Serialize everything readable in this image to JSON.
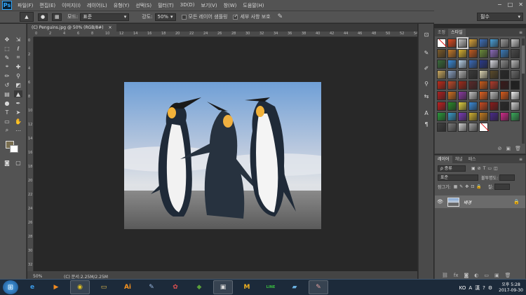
{
  "menubar": {
    "logo": "Ps",
    "items": [
      "파일(F)",
      "편집(E)",
      "이미지(I)",
      "레이어(L)",
      "유형(Y)",
      "선택(S)",
      "필터(T)",
      "3D(D)",
      "보기(V)",
      "창(W)",
      "도움말(H)"
    ],
    "window_controls": [
      "−",
      "□",
      "✕"
    ]
  },
  "options_bar": {
    "mode_label": "모드:",
    "mode_value": "표준",
    "strength_label": "강도:",
    "strength_value": "50%",
    "sample_all_layers_label": "모든 레이어 샘플링",
    "sample_all_layers_checked": false,
    "protect_detail_label": "세부 사항 보호",
    "protect_detail_checked": true,
    "workspace": "필수"
  },
  "document": {
    "tab_title": "(C) Penguins.jpg @ 50% (RGB/8#)",
    "tab_close": "×",
    "ruler_top_ticks": [
      "0",
      "2",
      "4",
      "6",
      "8",
      "10",
      "12",
      "14",
      "16",
      "18",
      "20",
      "22",
      "24",
      "26",
      "28",
      "30",
      "32",
      "34",
      "36",
      "38",
      "40",
      "42",
      "44",
      "46",
      "48",
      "50",
      "52",
      "54"
    ],
    "ruler_left_ticks": [
      "0",
      "2",
      "4",
      "6",
      "8",
      "10",
      "12",
      "14",
      "16",
      "18",
      "20",
      "22",
      "24",
      "26",
      "28",
      "30",
      "32"
    ]
  },
  "status_bar": {
    "zoom": "50%",
    "doc_info": "(C) 문서:2.25M/2.25M"
  },
  "panels": {
    "top_tabs": [
      "조정",
      "스타일"
    ],
    "top_active": "스타일",
    "style_swatch_colors": [
      "none",
      "#e04a1f",
      "#bfbfbf",
      "#d9a33a",
      "#3d6fb8",
      "#4aa0d8",
      "#9a9a9a",
      "#c8c8c8",
      "#7a5a2a",
      "#c47a2a",
      "#d8b030",
      "#c05a20",
      "#6a8a3a",
      "#8a6ab8",
      "#3a7ab8",
      "#4a4a4a",
      "#3a6a3a",
      "#3a8ad8",
      "#b8d0e8",
      "#3a6ab8",
      "#2a3a8a",
      "#d8d8e0",
      "#8a8a8a",
      "#b8b8b8",
      "#c8a860",
      "#8aa0c0",
      "#b0b0b0",
      "#3a3a3a",
      "#d8d0b0",
      "#5a4a2a",
      "#2a2a2a",
      "#6a6a6a",
      "#c02a1a",
      "#c04a2a",
      "#a02a1a",
      "#5a2a2a",
      "#c85a1a",
      "#b03a2a",
      "#3a1a1a",
      "#202020",
      "#b02020",
      "#d07020",
      "#8a3aa0",
      "#c0c0c0",
      "#e06020",
      "#b8b8b8",
      "#d85a1a",
      "#f0f0f0",
      "#c02020",
      "#2a8a2a",
      "#e0d040",
      "#3a8ad8",
      "#c84a20",
      "#8a1a1a",
      "#2a2a2a",
      "#d0d0d0",
      "#2a9a3a",
      "#3a9ac8",
      "#7a3ab8",
      "#d0b030",
      "#c07a20",
      "#4a2a8a",
      "#d02a8a",
      "#3aaa5a",
      "#404040",
      "#7a7a7a",
      "#cfcfcf",
      "#a0a0a0",
      "none"
    ],
    "layers_tabs": [
      "레이어",
      "채널",
      "패스"
    ],
    "layers_active": "레이어",
    "filter_label": "ρ 종류",
    "blend_mode": "표준",
    "opacity_label": "불투명도:",
    "lock_label": "잠그기:",
    "fill_label": "칠:",
    "layer_name": "배경"
  },
  "taskbar": {
    "apps": [
      {
        "icon": "ie-icon",
        "glyph": "e",
        "color": "#3a9ae8",
        "running": false
      },
      {
        "icon": "media-player-icon",
        "glyph": "▶",
        "color": "#f08a20",
        "running": false
      },
      {
        "icon": "chrome-icon",
        "glyph": "◉",
        "color": "#e0c020",
        "running": true
      },
      {
        "icon": "explorer-icon",
        "glyph": "▭",
        "color": "#e8c050",
        "running": false
      },
      {
        "icon": "illustrator-icon",
        "glyph": "Ai",
        "color": "#f7931e",
        "running": false
      },
      {
        "icon": "pencil-app-icon",
        "glyph": "✎",
        "color": "#9ab8e0",
        "running": false
      },
      {
        "icon": "paint-icon",
        "glyph": "✿",
        "color": "#e05050",
        "running": false
      },
      {
        "icon": "minecraft-icon",
        "glyph": "◆",
        "color": "#5aa03a",
        "running": false
      },
      {
        "icon": "window-app-icon",
        "glyph": "▣",
        "color": "#d8d8d8",
        "running": true
      },
      {
        "icon": "notes-app-icon",
        "glyph": "M",
        "color": "#f0b020",
        "running": false
      },
      {
        "icon": "line-icon",
        "glyph": "LINE",
        "color": "#3ac040",
        "running": false
      },
      {
        "icon": "book-icon",
        "glyph": "▰",
        "color": "#6ab0e0",
        "running": false
      },
      {
        "icon": "photoshop-task-icon",
        "glyph": "✎",
        "color": "#e0a0a0",
        "running": true
      }
    ],
    "tray_text": [
      "KO",
      "A",
      "漢",
      "?",
      "⚙"
    ],
    "time": "오후 5:28",
    "date": "2017-09-30"
  }
}
